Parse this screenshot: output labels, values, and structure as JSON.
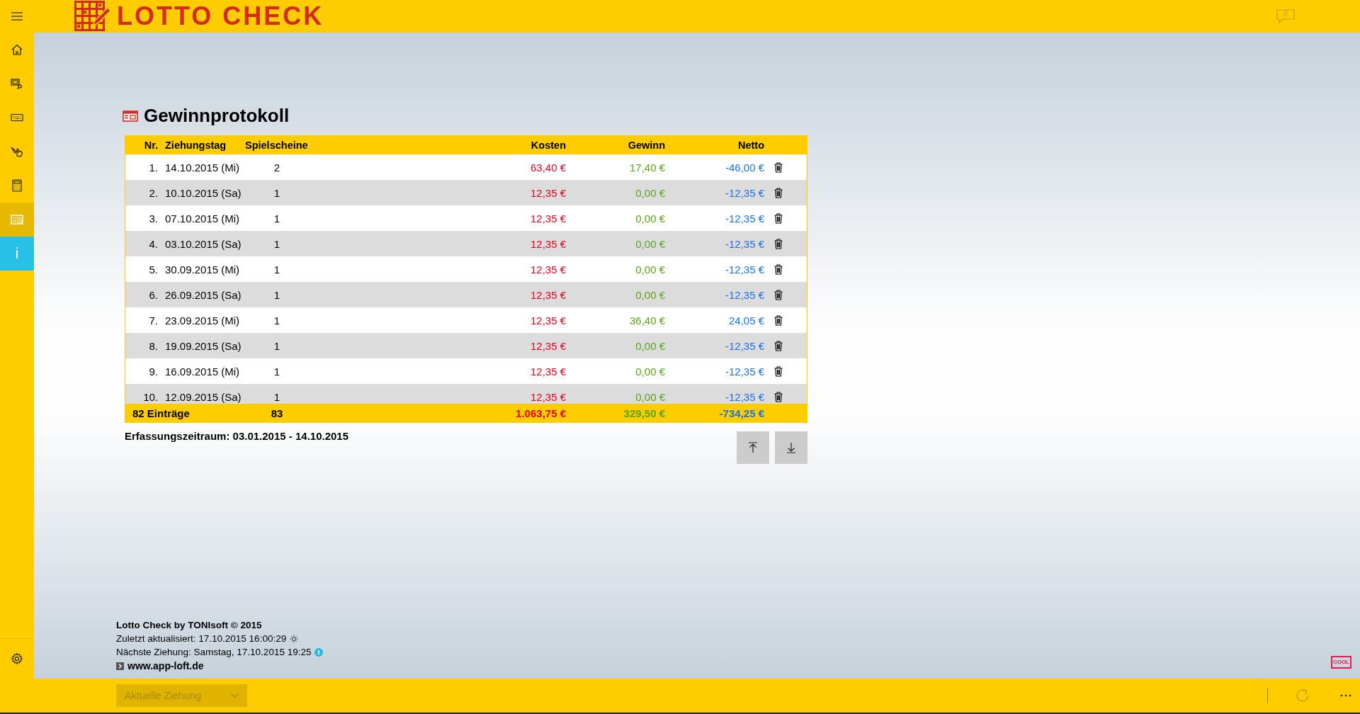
{
  "app": {
    "title": "LOTTO CHECK",
    "notifications": "0"
  },
  "sidebar": {
    "items": [
      {
        "kind": "home",
        "selected": false
      },
      {
        "kind": "monitor",
        "selected": false
      },
      {
        "kind": "keyboard",
        "selected": false
      },
      {
        "kind": "hand",
        "selected": false
      },
      {
        "kind": "calculator",
        "selected": false
      },
      {
        "kind": "news",
        "selected": true
      },
      {
        "kind": "info",
        "label": "i",
        "selected": false
      }
    ],
    "settings": {
      "kind": "settings"
    }
  },
  "page": {
    "title": "Gewinnprotokoll"
  },
  "table": {
    "columns": [
      "Nr.",
      "Ziehungstag",
      "Spielscheine",
      "Kosten",
      "Gewinn",
      "Netto"
    ],
    "rows": [
      {
        "nr": "1.",
        "date": "14.10.2015 (Mi)",
        "tickets": "2",
        "cost": "63,40 €",
        "win": "17,40 €",
        "net": "-46,00 €"
      },
      {
        "nr": "2.",
        "date": "10.10.2015 (Sa)",
        "tickets": "1",
        "cost": "12,35 €",
        "win": "0,00 €",
        "net": "-12,35 €"
      },
      {
        "nr": "3.",
        "date": "07.10.2015 (Mi)",
        "tickets": "1",
        "cost": "12,35 €",
        "win": "0,00 €",
        "net": "-12,35 €"
      },
      {
        "nr": "4.",
        "date": "03.10.2015 (Sa)",
        "tickets": "1",
        "cost": "12,35 €",
        "win": "0,00 €",
        "net": "-12,35 €"
      },
      {
        "nr": "5.",
        "date": "30.09.2015 (Mi)",
        "tickets": "1",
        "cost": "12,35 €",
        "win": "0,00 €",
        "net": "-12,35 €"
      },
      {
        "nr": "6.",
        "date": "26.09.2015 (Sa)",
        "tickets": "1",
        "cost": "12,35 €",
        "win": "0,00 €",
        "net": "-12,35 €"
      },
      {
        "nr": "7.",
        "date": "23.09.2015 (Mi)",
        "tickets": "1",
        "cost": "12,35 €",
        "win": "36,40 €",
        "net": "24,05 €"
      },
      {
        "nr": "8.",
        "date": "19.09.2015 (Sa)",
        "tickets": "1",
        "cost": "12,35 €",
        "win": "0,00 €",
        "net": "-12,35 €"
      },
      {
        "nr": "9.",
        "date": "16.09.2015 (Mi)",
        "tickets": "1",
        "cost": "12,35 €",
        "win": "0,00 €",
        "net": "-12,35 €"
      },
      {
        "nr": "10.",
        "date": "12.09.2015 (Sa)",
        "tickets": "1",
        "cost": "12,35 €",
        "win": "0,00 €",
        "net": "-12,35 €"
      }
    ],
    "totals": {
      "entries": "82 Einträge",
      "tickets": "83",
      "cost": "1.063,75 €",
      "win": "329,50 €",
      "net": "-734,25 €"
    }
  },
  "period": "Erfassungszeitraum: 03.01.2015 - 14.10.2015",
  "footer": {
    "credit": "Lotto Check by TONIsoft © 2015",
    "updated": "Zuletzt aktualisiert: 17.10.2015 16:00:29",
    "next_draw": "Nächste Ziehung: Samstag, 17.10.2015 19:25",
    "link": "www.app-loft.de",
    "badge": "COOL"
  },
  "bottom_bar": {
    "dropdown": {
      "value": "Aktuelle Ziehung",
      "disabled": true
    }
  }
}
